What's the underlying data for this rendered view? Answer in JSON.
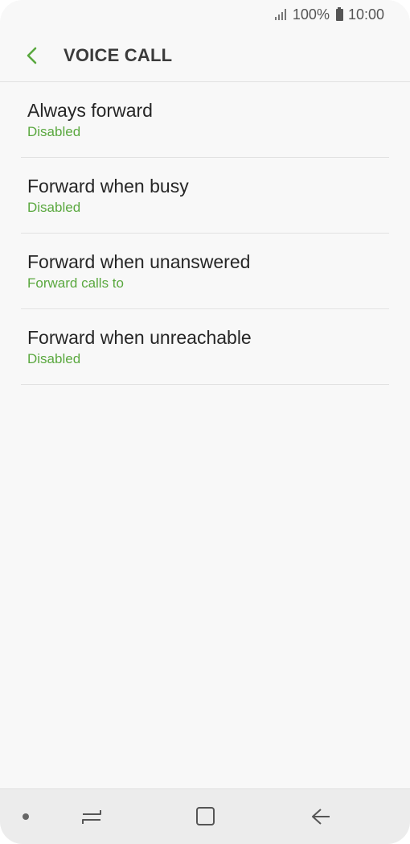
{
  "status_bar": {
    "battery_text": "100%",
    "time": "10:00",
    "icons": [
      "signal-icon",
      "battery-icon"
    ]
  },
  "header": {
    "back_icon": "chevron-left-icon",
    "title": "VOICE CALL"
  },
  "list": {
    "items": [
      {
        "title": "Always forward",
        "subtitle": "Disabled"
      },
      {
        "title": "Forward when busy",
        "subtitle": "Disabled"
      },
      {
        "title": "Forward when unanswered",
        "subtitle": "Forward calls to"
      },
      {
        "title": "Forward when unreachable",
        "subtitle": "Disabled"
      }
    ]
  },
  "nav_bar": {
    "icons": [
      "nav-dot-icon",
      "recent-apps-icon",
      "home-icon",
      "back-arrow-icon"
    ]
  },
  "colors": {
    "accent": "#5aa83f",
    "background": "#f8f8f8",
    "nav_background": "#ececec"
  }
}
